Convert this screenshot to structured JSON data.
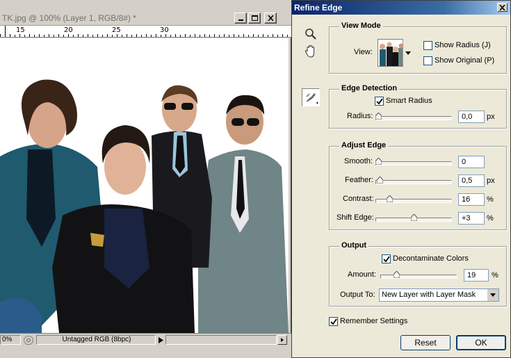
{
  "document": {
    "title": "TK.jpg @ 100% (Layer 1, RGB/8#) *",
    "ruler_labels": [
      "15",
      "20",
      "25",
      "30"
    ],
    "zoom": "0%",
    "color_profile": "Untagged RGB (8bpc)"
  },
  "dialog": {
    "title": "Refine Edge",
    "view_mode": {
      "label": "View Mode",
      "view_label": "View:",
      "show_radius": {
        "label": "Show Radius (J)",
        "checked": false
      },
      "show_original": {
        "label": "Show Original (P)",
        "checked": false
      }
    },
    "edge_detection": {
      "label": "Edge Detection",
      "smart_radius": {
        "label": "Smart Radius",
        "checked": true
      },
      "radius": {
        "label": "Radius:",
        "value": "0,0",
        "unit": "px",
        "position": 0.0
      }
    },
    "adjust_edge": {
      "label": "Adjust Edge",
      "smooth": {
        "label": "Smooth:",
        "value": "0",
        "unit": "",
        "position": 0.0
      },
      "feather": {
        "label": "Feather:",
        "value": "0,5",
        "unit": "px",
        "position": 0.02
      },
      "contrast": {
        "label": "Contrast:",
        "value": "16",
        "unit": "%",
        "position": 0.16
      },
      "shift_edge": {
        "label": "Shift Edge:",
        "value": "+3",
        "unit": "%",
        "position": 0.515
      }
    },
    "output": {
      "label": "Output",
      "decontaminate": {
        "label": "Decontaminate Colors",
        "checked": true
      },
      "amount": {
        "label": "Amount:",
        "value": "19",
        "unit": "%",
        "position": 0.19
      },
      "output_to_label": "Output To:",
      "output_to_value": "New Layer with Layer Mask"
    },
    "remember": {
      "label": "Remember Settings",
      "checked": true
    },
    "reset_label": "Reset",
    "ok_label": "OK"
  },
  "icons": {
    "zoom": "magnifier-icon",
    "hand": "hand-icon",
    "refine_brush": "refine-radius-brush-icon"
  },
  "colors": {
    "titlebar_start": "#0a246a",
    "titlebar_end": "#a6caf0",
    "dialog_bg": "#ece9d8"
  }
}
